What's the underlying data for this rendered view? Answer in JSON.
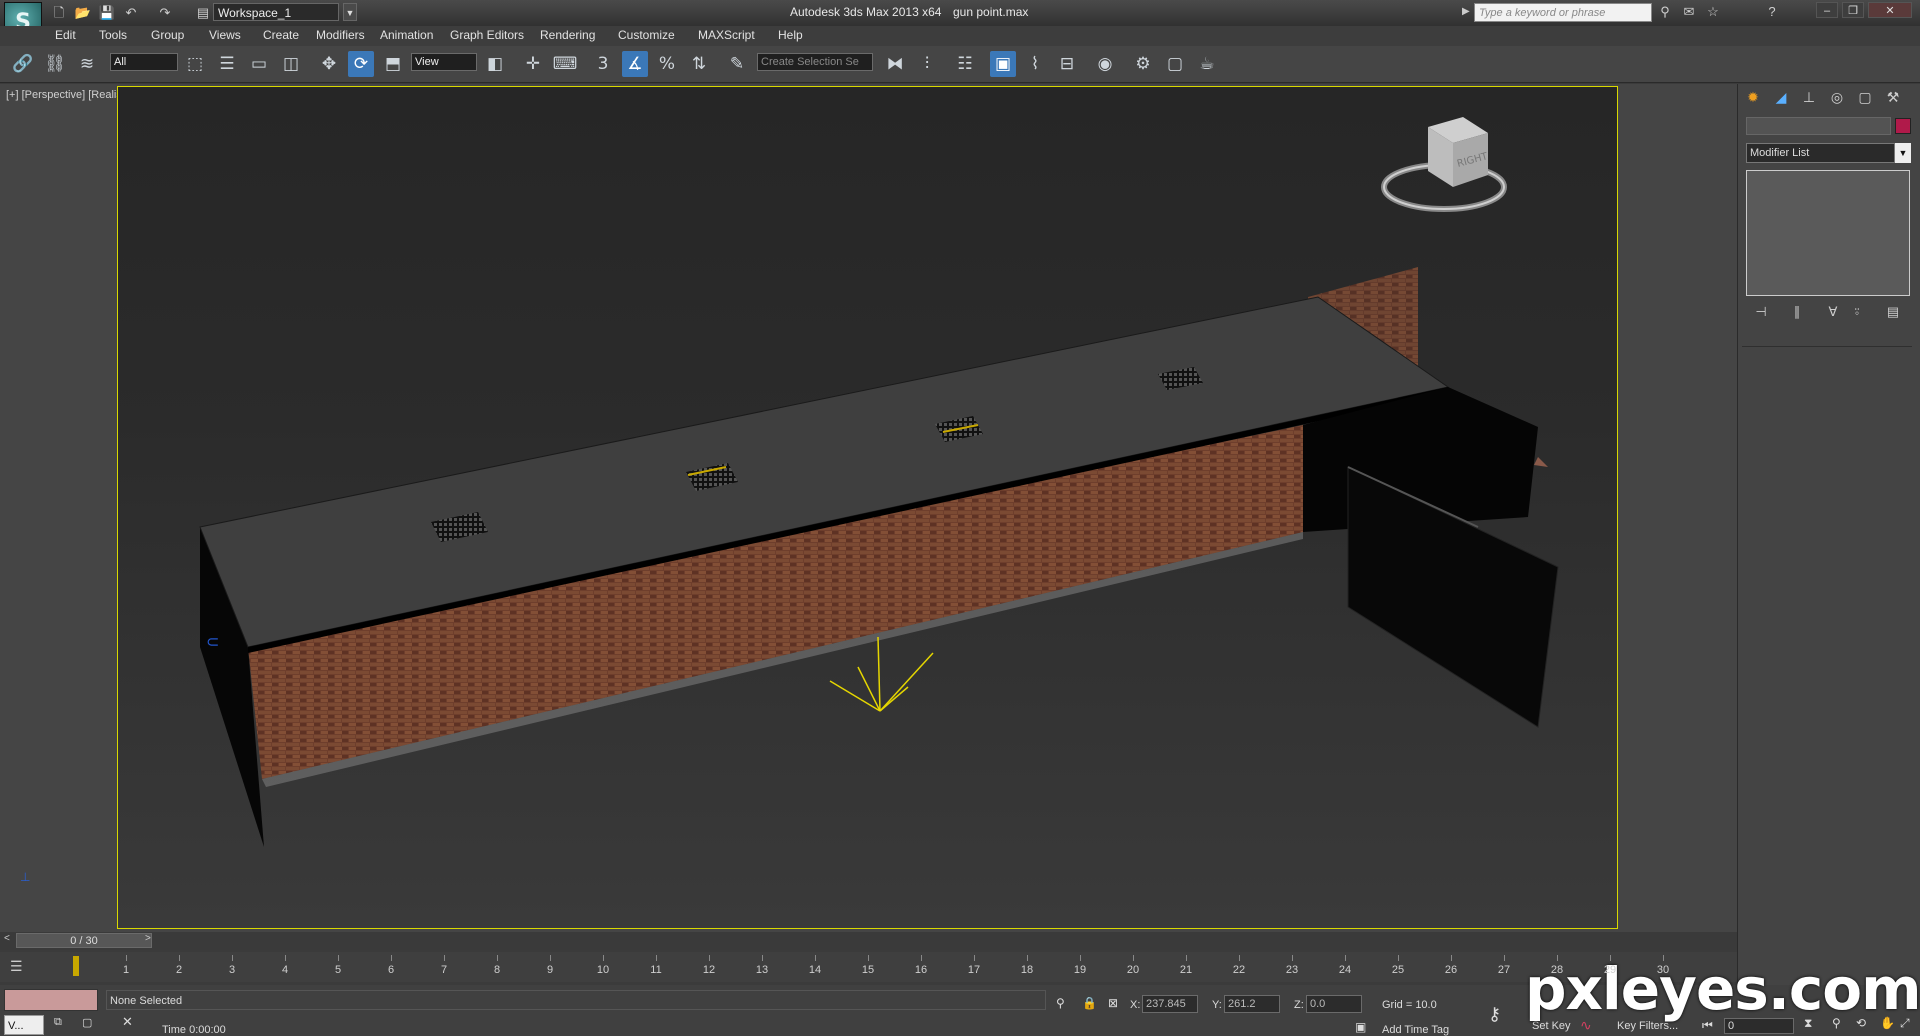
{
  "titlebar": {
    "logo_glyph": "S",
    "workspace": "Workspace_1",
    "app_title": "Autodesk 3ds Max  2013 x64",
    "file_name": "gun point.max",
    "search_placeholder": "Type a keyword or phrase",
    "quick_access_icons": [
      "new-icon",
      "open-icon",
      "save-icon",
      "undo-icon",
      "redo-icon",
      "project-folder-icon"
    ]
  },
  "menu": [
    "Edit",
    "Tools",
    "Group",
    "Views",
    "Create",
    "Modifiers",
    "Animation",
    "Graph Editors",
    "Rendering",
    "Customize",
    "MAXScript",
    "Help"
  ],
  "toolbar": {
    "selection_filter": "All",
    "reference_coord": "View",
    "named_selection_placeholder": "Create Selection Se",
    "snap_label": "3",
    "percent_label": "%"
  },
  "viewport": {
    "label": "[+] [Perspective] [Realistic]  <<Disabled>>",
    "viewcube_face": "RIGHT"
  },
  "command_panel": {
    "modifier_list": "Modifier List",
    "accent_color": "#b01a4a"
  },
  "timeline": {
    "slider_label": "0 / 30",
    "ticks": [
      "1",
      "2",
      "3",
      "4",
      "5",
      "6",
      "7",
      "8",
      "9",
      "10",
      "11",
      "12",
      "13",
      "14",
      "15",
      "16",
      "17",
      "18",
      "19",
      "20",
      "21",
      "22",
      "23",
      "24",
      "25",
      "26",
      "27",
      "28",
      "29",
      "30"
    ]
  },
  "status": {
    "selection": "None Selected",
    "time": "Time  0:00:00",
    "x_label": "X:",
    "x_value": "237.845",
    "y_label": "Y:",
    "y_value": "261.2",
    "z_label": "Z:",
    "z_value": "0.0",
    "grid": "Grid = 10.0",
    "add_time_tag": "Add Time Tag",
    "set_key": "Set Key",
    "key_filters": "Key Filters...",
    "frame": "0",
    "taskbar_label": "V..."
  },
  "watermark": "pxleyes.com"
}
